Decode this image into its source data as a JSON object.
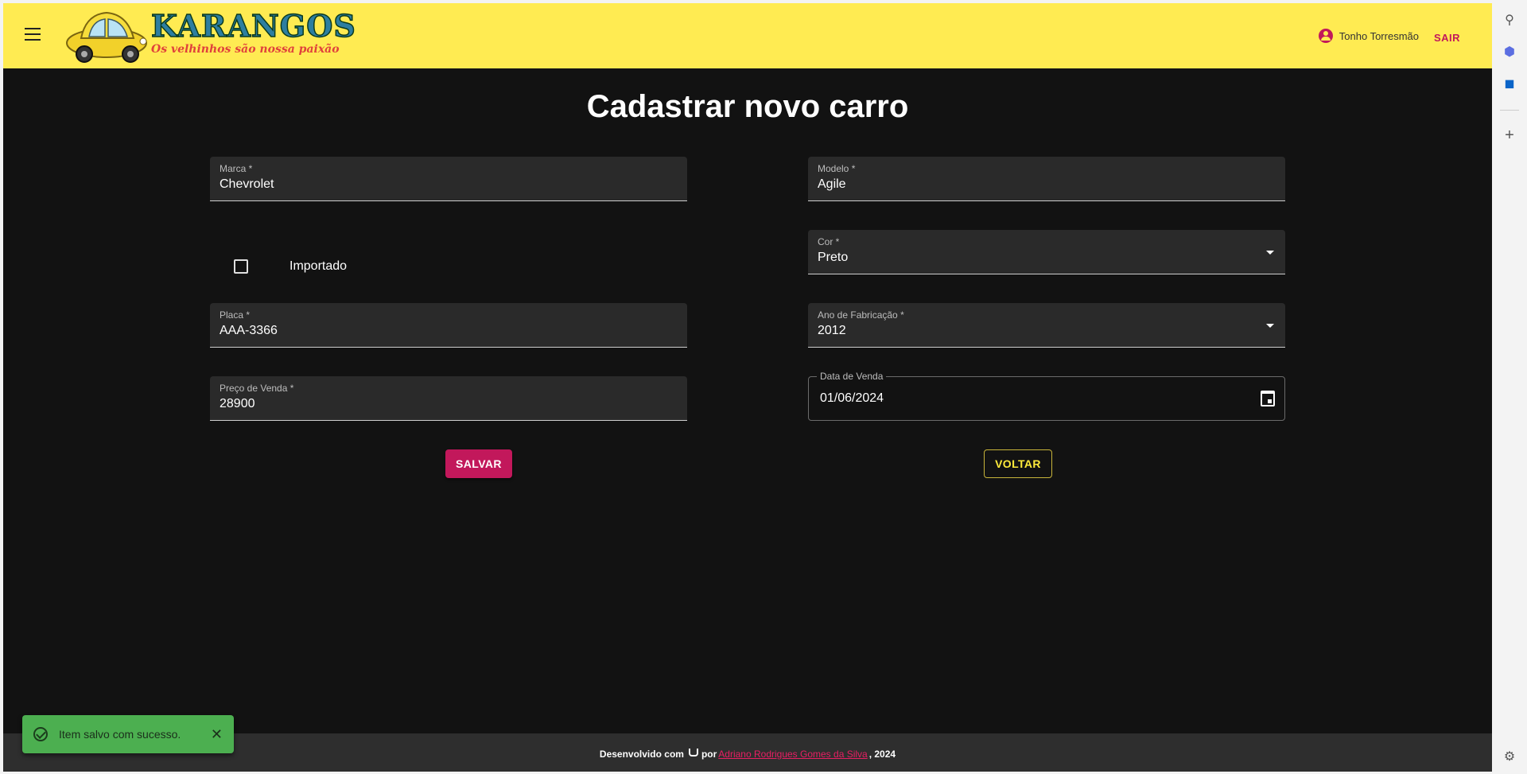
{
  "header": {
    "logo_title": "KARANGOS",
    "logo_subtitle": "Os velhinhos são nossa paixão",
    "user_name": "Tonho Torresmão",
    "logout_label": "SAIR"
  },
  "page": {
    "title": "Cadastrar novo carro"
  },
  "form": {
    "marca": {
      "label": "Marca *",
      "value": "Chevrolet"
    },
    "modelo": {
      "label": "Modelo *",
      "value": "Agile"
    },
    "importado": {
      "label": "Importado",
      "checked": false
    },
    "cor": {
      "label": "Cor *",
      "value": "Preto"
    },
    "placa": {
      "label": "Placa *",
      "value": "AAA-3366"
    },
    "ano": {
      "label": "Ano de Fabricação *",
      "value": "2012"
    },
    "preco": {
      "label": "Preço de Venda *",
      "value": "28900"
    },
    "data_venda": {
      "label": "Data de Venda",
      "value": "01/06/2024"
    },
    "save_label": "SALVAR",
    "back_label": "VOLTAR"
  },
  "footer": {
    "prefix": "Desenvolvido com",
    "by": "por",
    "author": "Adriano Rodrigues Gomes da Silva",
    "suffix": ", 2024"
  },
  "snackbar": {
    "message": "Item salvo com sucesso.",
    "close_glyph": "✕"
  },
  "colors": {
    "topbar": "#ffeb52",
    "background": "#121212",
    "primary": "#c2185b",
    "secondary": "#ffeb3b",
    "success": "#4caf50"
  }
}
